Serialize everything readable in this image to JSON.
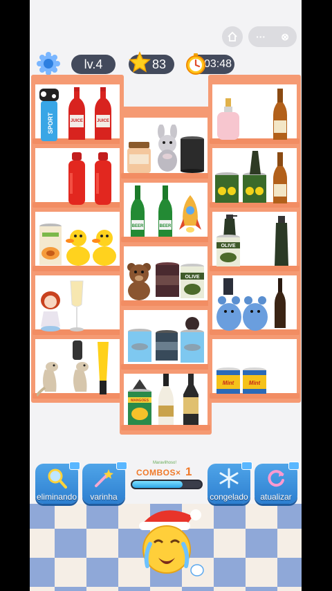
{
  "status": {
    "level": "lv.4",
    "stars": "83",
    "timer": "03:48"
  },
  "capsule": {
    "home_icon": "home-icon",
    "more_icon": "more-dots-icon",
    "close_icon": "close-icon",
    "more_text": "···",
    "close_text": "⊗"
  },
  "boosters": {
    "magnify_label": "eliminando",
    "wand_label": "varinha",
    "freeze_label": "congelado",
    "refresh_label": "atualizar"
  },
  "combo": {
    "caption": "Maravilhoso!",
    "label": "COMBOS×",
    "count": "1",
    "progress": 0.73
  },
  "labels": {
    "sport": "SPORT",
    "juice": "JUICE",
    "beer": "BEER",
    "olive": "OLIVE",
    "mango": "MANGOES",
    "mint": "Mint"
  },
  "colors": {
    "shelf": "#f59a73",
    "shelf_lip": "#f28d63",
    "booster": "#3b8fdc",
    "combo_text": "#f07a2a"
  }
}
